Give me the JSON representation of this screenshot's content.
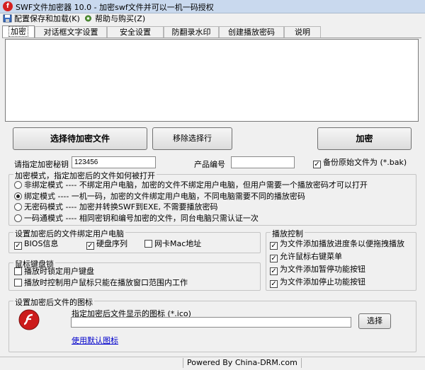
{
  "window": {
    "title": "SWF文件加密器 10.0 - 加密swf文件并可以一机一码授权",
    "app_icon": "flash-logo-icon"
  },
  "menu": {
    "items": [
      {
        "label": "配置保存和加载(K)",
        "icon": "save-config-icon"
      },
      {
        "label": "帮助与购买(Z)",
        "icon": "gear-help-icon"
      }
    ]
  },
  "tabs": [
    "加密",
    "对话框文字设置",
    "安全设置",
    "防翻录水印",
    "创建播放密码",
    "说明"
  ],
  "buttons": {
    "select_files": "选择待加密文件",
    "remove_selected": "移除选择行",
    "encrypt": "加密",
    "browse": "选择"
  },
  "key": {
    "label": "请指定加密秘钥",
    "value": "123456"
  },
  "product": {
    "label": "产品编号",
    "value": ""
  },
  "backup": {
    "label": "备份原始文件为 (*.bak)",
    "checked": true
  },
  "mode_group": {
    "title": "加密模式，指定加密后的文件如何被打开",
    "options": [
      {
        "text": "非绑定模式 ---- 不绑定用户电脑，加密的文件不绑定用户电脑，但用户需要一个播放密码才可以打开",
        "selected": false
      },
      {
        "text": "绑定模式 ---- 一机一码，加密的文件绑定用户电脑，不同电脑需要不同的播放密码",
        "selected": true
      },
      {
        "text": "无密码模式 ---- 加密并转换SWF到EXE, 不需要播放密码",
        "selected": false
      },
      {
        "text": "一码通模式 ---- 相同密钥和编号加密的文件，同台电脑只需认证一次",
        "selected": false
      }
    ]
  },
  "bind_group": {
    "title": "设置加密后的文件绑定用户电脑",
    "items": [
      {
        "text": "BIOS信息",
        "checked": true
      },
      {
        "text": "硬盘序列",
        "checked": true
      },
      {
        "text": "网卡Mac地址",
        "checked": false
      }
    ]
  },
  "lock_group": {
    "title": "鼠标键盘锁",
    "items": [
      {
        "text": "播放时锁定用户键盘",
        "checked": false
      },
      {
        "text": "播放时控制用户鼠标只能在播放窗口范围内工作",
        "checked": false
      }
    ]
  },
  "play_group": {
    "title": "播放控制",
    "items": [
      {
        "text": "为文件添加播放进度条以便拖拽播放",
        "checked": true
      },
      {
        "text": "允许鼠标右键菜单",
        "checked": true
      },
      {
        "text": "为文件添加暂停功能按钮",
        "checked": true
      },
      {
        "text": "为文件添加停止功能按钮",
        "checked": true
      }
    ]
  },
  "icon_group": {
    "title": "设置加密后文件的图标",
    "prompt": "指定加密后文件显示的图标 (*.ico)",
    "path_value": "",
    "default_link": "使用默认图标"
  },
  "status": {
    "text": "Powered By China-DRM.com"
  }
}
